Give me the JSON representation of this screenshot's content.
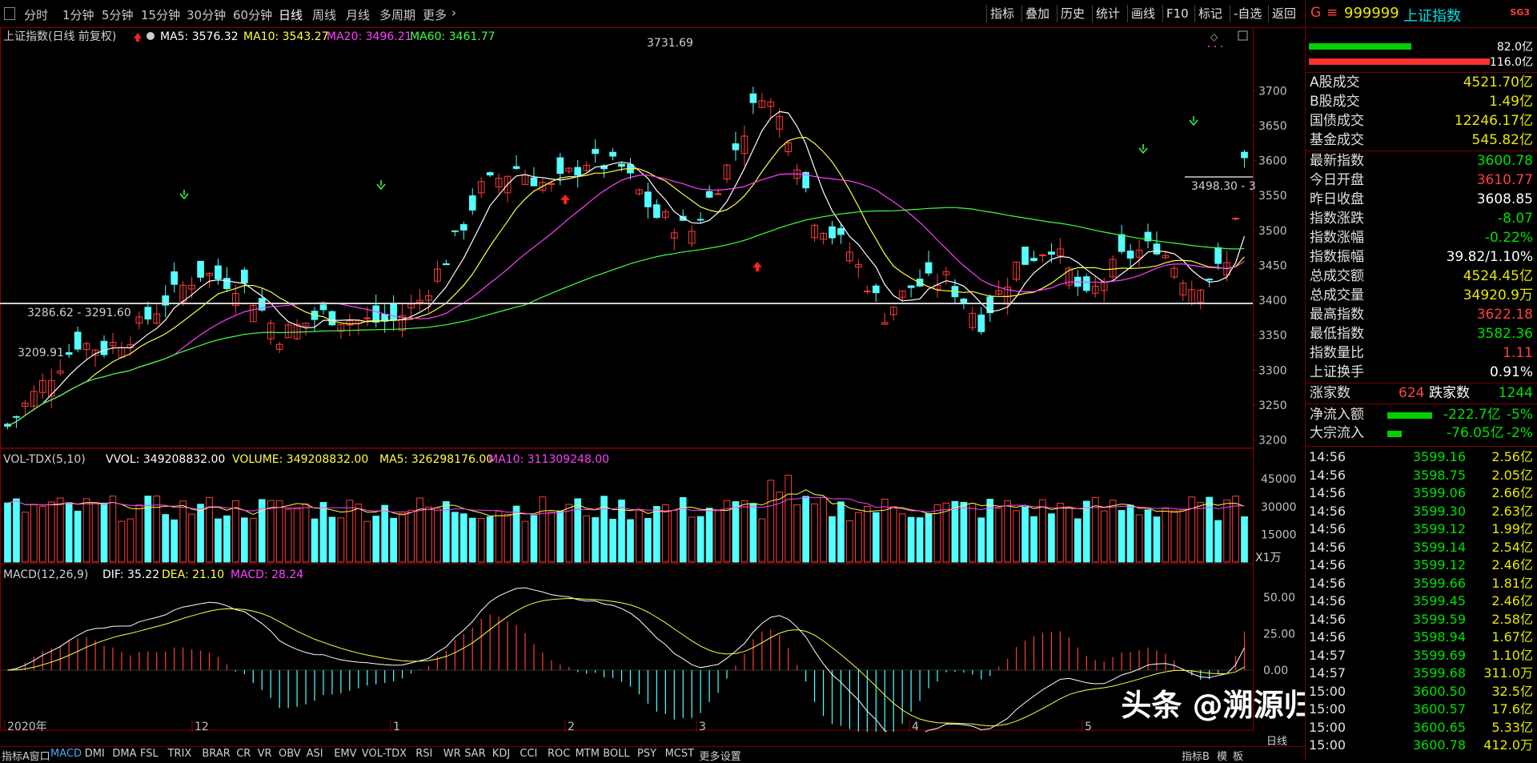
{
  "toolbar": {
    "periods": [
      "分时",
      "1分钟",
      "5分钟",
      "15分钟",
      "30分钟",
      "60分钟",
      "日线",
      "周线",
      "月线",
      "多周期",
      "更多"
    ],
    "active_period": "日线",
    "right_buttons": [
      "指标",
      "叠加",
      "历史",
      "统计",
      "画线",
      "F10",
      "标记",
      "-自选",
      "返回"
    ]
  },
  "kline_header": {
    "title": "上证指数(日线 前复权)",
    "ma5": "MA5: 3576.32",
    "ma10": "MA10: 3543.27",
    "ma20": "MA20: 3496.21",
    "ma60": "MA60: 3461.77"
  },
  "vol_header": {
    "title": "VOL-TDX(5,10)",
    "vvol": "VVOL: 349208832.00",
    "volume": "VOLUME: 349208832.00",
    "ma5": "MA5: 326298176.00",
    "ma10": "MA10: 311309248.00"
  },
  "macd_header": {
    "title": "MACD(12,26,9)",
    "dif": "DIF: 35.22",
    "dea": "DEA: 21.10",
    "macd": "MACD: 28.24"
  },
  "chart_annotations": {
    "high": "3731.69",
    "low": "3209.91",
    "left_level": "3286.62 - 3291.60",
    "right_level": "3498.30 - 3",
    "vol_unit": "X1万"
  },
  "chart_data": [
    {
      "type": "candlestick",
      "series_name": "上证指数",
      "y_ticks": [
        3200,
        3250,
        3300,
        3350,
        3400,
        3450,
        3500,
        3550,
        3600,
        3650,
        3700
      ],
      "ylim": [
        3195,
        3745
      ],
      "x_labels": [
        "2020年",
        "12",
        "1",
        "2",
        "3",
        "4",
        "5"
      ],
      "last_close": 3600.78,
      "period_high": 3731.69,
      "period_low": 3209.91
    },
    {
      "type": "bar",
      "series_name": "VOL-TDX(5,10)",
      "y_ticks": [
        15000,
        30000,
        45000
      ],
      "ylim": [
        0,
        52000
      ]
    },
    {
      "type": "bar",
      "series_name": "MACD(12,26,9)",
      "y_ticks": [
        0.0,
        25.0,
        50.0
      ],
      "ylim": [
        -40,
        62
      ],
      "dif": 35.22,
      "dea": 21.1,
      "macd": 28.24
    }
  ],
  "bottom_tabs": [
    "指标A",
    "窗口",
    "MACD",
    "DMI",
    "DMA",
    "FSL",
    "TRIX",
    "BRAR",
    "CR",
    "VR",
    "OBV",
    "ASI",
    "EMV",
    "VOL-TDX",
    "RSI",
    "WR",
    "SAR",
    "KDJ",
    "CCI",
    "ROC",
    "MTM",
    "BOLL",
    "PSY",
    "MCST",
    "更多",
    "设置"
  ],
  "bottom_right_tabs": [
    "指标B",
    "模",
    "板"
  ],
  "bottom_right_label": "日线",
  "watermark": "头条 @溯源归一",
  "right_panel": {
    "code_prefix": "G",
    "code": "999999",
    "name": "上证指数",
    "badge": "SG3",
    "bar1_value": "82.0亿",
    "bar2_value": "116.0亿",
    "turnover": [
      {
        "label": "A股成交",
        "value": "4521.70亿"
      },
      {
        "label": "B股成交",
        "value": "1.49亿"
      },
      {
        "label": "国债成交",
        "value": "12246.17亿"
      },
      {
        "label": "基金成交",
        "value": "545.82亿"
      }
    ],
    "stats": [
      {
        "label": "最新指数",
        "value": "3600.78",
        "color": "green"
      },
      {
        "label": "今日开盘",
        "value": "3610.77",
        "color": "red"
      },
      {
        "label": "昨日收盘",
        "value": "3608.85",
        "color": "white"
      },
      {
        "label": "指数涨跌",
        "value": "-8.07",
        "color": "green"
      },
      {
        "label": "指数涨幅",
        "value": "-0.22%",
        "color": "green"
      },
      {
        "label": "指数振幅",
        "value": "39.82/1.10%",
        "color": "white"
      },
      {
        "label": "总成交额",
        "value": "4524.45亿",
        "color": "yellow"
      },
      {
        "label": "总成交量",
        "value": "34920.9万",
        "color": "yellow"
      },
      {
        "label": "最高指数",
        "value": "3622.18",
        "color": "red"
      },
      {
        "label": "最低指数",
        "value": "3582.36",
        "color": "green"
      },
      {
        "label": "指数量比",
        "value": "1.11",
        "color": "red"
      },
      {
        "label": "上证换手",
        "value": "0.91%",
        "color": "white"
      }
    ],
    "rise_label": "涨家数",
    "rise_count": "624",
    "fall_label": "跌家数",
    "fall_count": "1244",
    "net_inflow_label": "净流入额",
    "net_inflow_value": "-222.7亿",
    "net_inflow_pct": "-5%",
    "block_inflow_label": "大宗流入",
    "block_inflow_value": "-76.05亿",
    "block_inflow_pct": "-2%",
    "ticks": [
      {
        "time": "14:56",
        "price": "3599.16",
        "vol": "2.56亿"
      },
      {
        "time": "14:56",
        "price": "3598.75",
        "vol": "2.05亿"
      },
      {
        "time": "14:56",
        "price": "3599.06",
        "vol": "2.66亿"
      },
      {
        "time": "14:56",
        "price": "3599.30",
        "vol": "2.63亿"
      },
      {
        "time": "14:56",
        "price": "3599.12",
        "vol": "1.99亿"
      },
      {
        "time": "14:56",
        "price": "3599.14",
        "vol": "2.54亿"
      },
      {
        "time": "14:56",
        "price": "3599.12",
        "vol": "2.46亿"
      },
      {
        "time": "14:56",
        "price": "3599.66",
        "vol": "1.81亿"
      },
      {
        "time": "14:56",
        "price": "3599.45",
        "vol": "2.46亿"
      },
      {
        "time": "14:56",
        "price": "3599.59",
        "vol": "2.58亿"
      },
      {
        "time": "14:56",
        "price": "3598.94",
        "vol": "1.67亿"
      },
      {
        "time": "14:57",
        "price": "3599.69",
        "vol": "1.10亿"
      },
      {
        "time": "14:57",
        "price": "3599.68",
        "vol": "311.0万"
      },
      {
        "time": "15:00",
        "price": "3600.50",
        "vol": "32.5亿"
      },
      {
        "time": "15:00",
        "price": "3600.57",
        "vol": "17.6亿"
      },
      {
        "time": "15:00",
        "price": "3600.65",
        "vol": "5.33亿"
      },
      {
        "time": "15:00",
        "price": "3600.78",
        "vol": "412.0万"
      }
    ]
  }
}
